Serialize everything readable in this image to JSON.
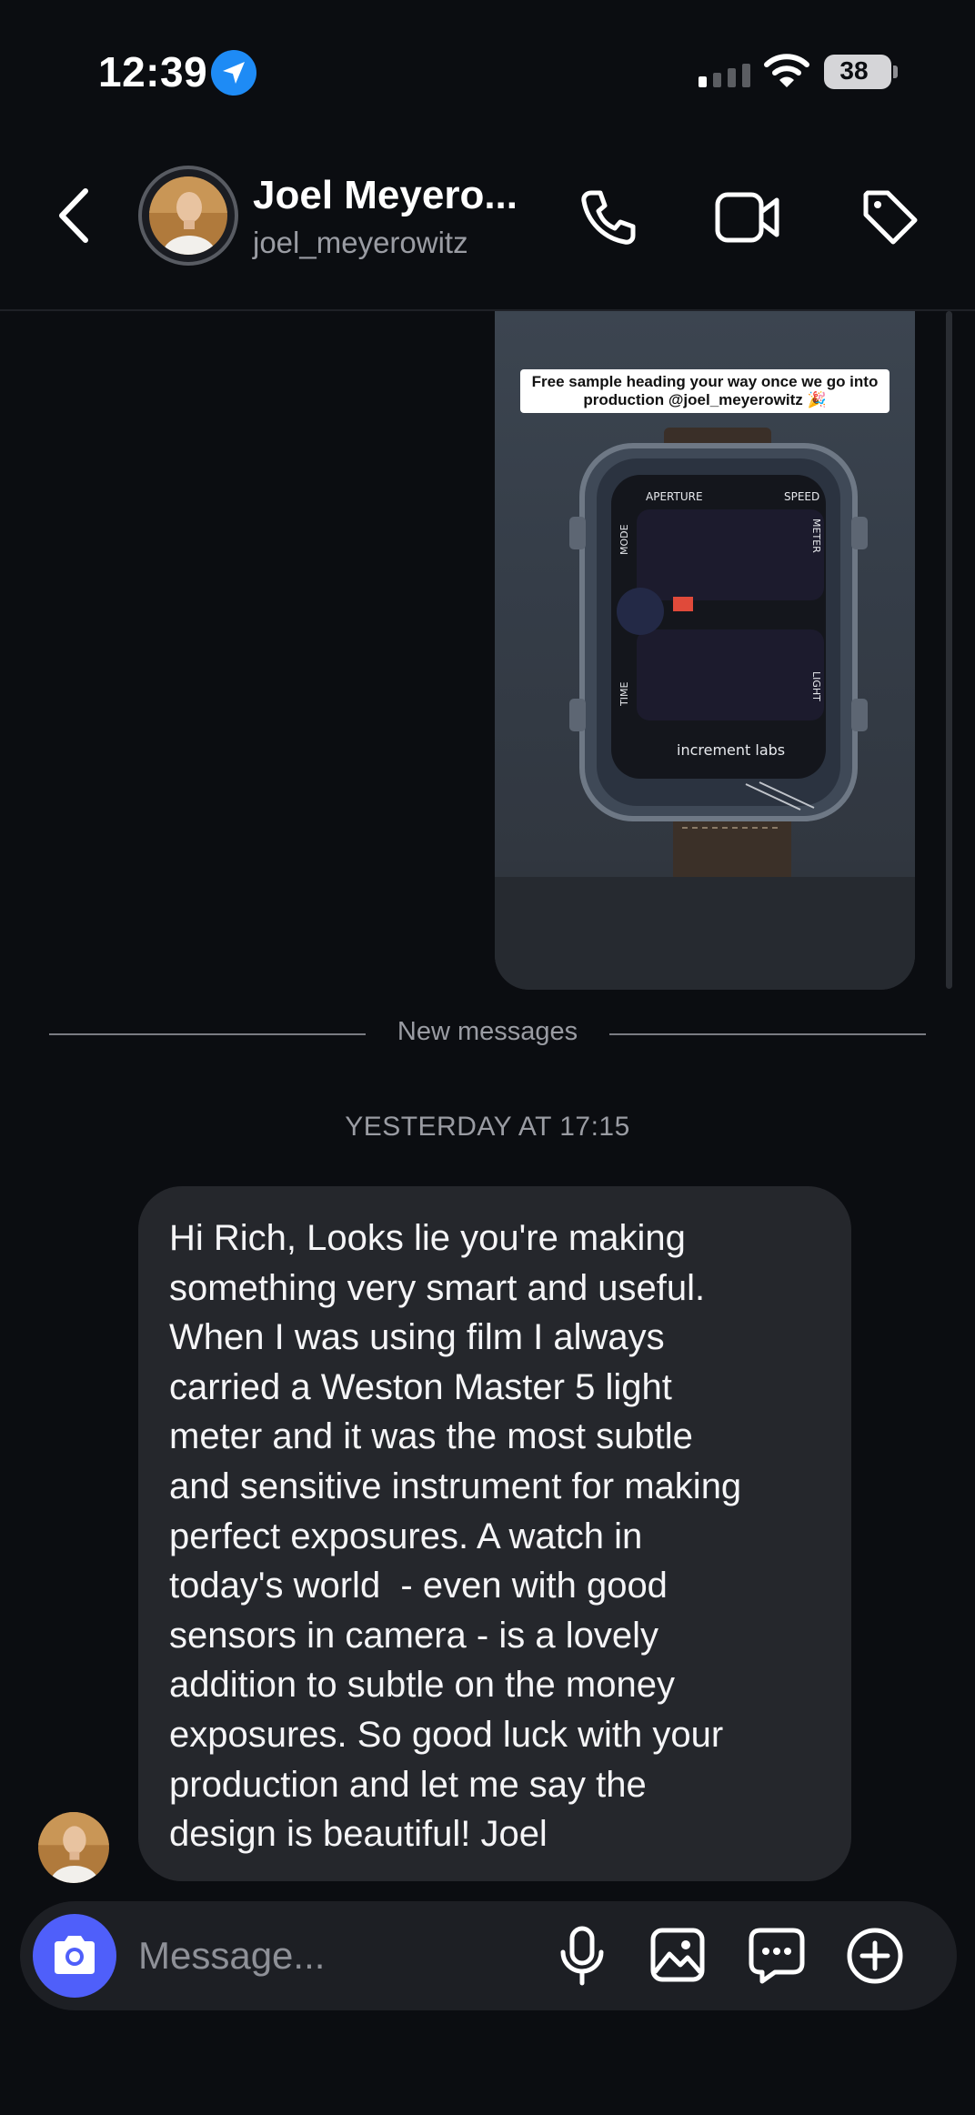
{
  "status_bar": {
    "time": "12:39",
    "battery": "38",
    "icons": [
      "location-arrow-icon",
      "cellular-signal-icon",
      "wifi-icon",
      "battery-icon"
    ]
  },
  "header": {
    "name": "Joel Meyero...",
    "username": "joel_meyerowitz",
    "icons": [
      "back-chevron-icon",
      "phone-icon",
      "video-camera-icon",
      "tag-icon"
    ]
  },
  "shared_story": {
    "caption": "Free sample heading your way once we go into production @joel_meyerowitz 🎉",
    "watch_labels": {
      "aperture": "APERTURE",
      "speed": "SPEED",
      "mode": "MODE",
      "meter": "METER",
      "time": "TIME",
      "light": "LIGHT",
      "brand": "increment labs"
    }
  },
  "divider": {
    "label": "New messages"
  },
  "timestamp": "YESTERDAY AT 17:15",
  "message": {
    "lines": [
      "Hi Rich, Looks lie you're making",
      "something very smart and useful.",
      "When I was using film I always",
      "carried a Weston Master 5 light",
      "meter and it was the most subtle",
      "and sensitive instrument for making",
      "perfect exposures. A watch in",
      "today's world  - even with good",
      "sensors in camera - is a lovely",
      "addition to subtle on the money",
      "exposures. So good luck with your",
      "production and let me say the",
      "design is beautiful! Joel"
    ]
  },
  "composer": {
    "placeholder": "Message...",
    "icons": [
      "camera-icon",
      "microphone-icon",
      "gallery-icon",
      "sticker-icon",
      "plus-icon"
    ]
  },
  "colors": {
    "background": "#0b0d11",
    "bubble": "#25272c",
    "camera_button": "#4f5ffa",
    "secondary_text": "#9a9ca3"
  }
}
